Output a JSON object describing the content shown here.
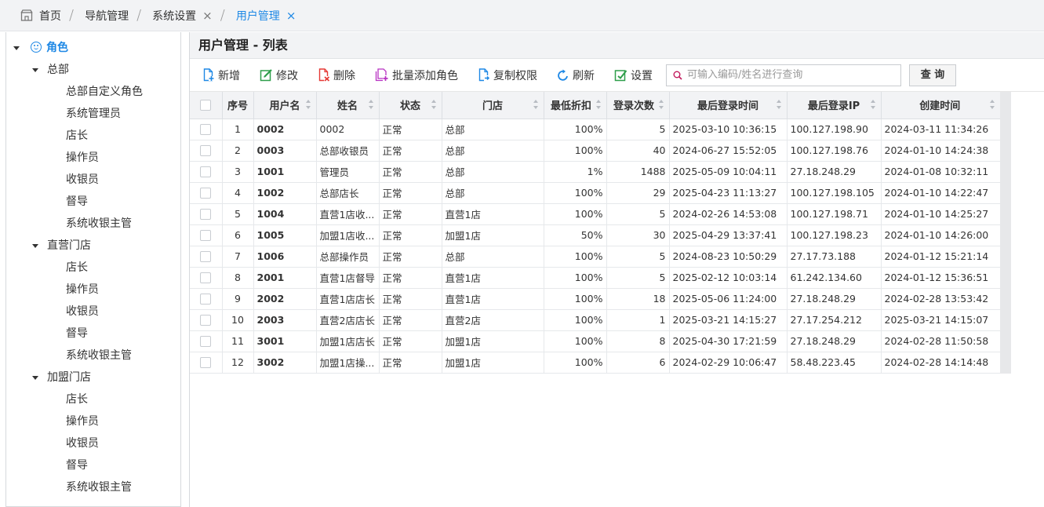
{
  "breadcrumb": {
    "items": [
      {
        "label": "首页"
      },
      {
        "label": "导航管理"
      },
      {
        "label": "系统设置"
      },
      {
        "label": "用户管理"
      }
    ],
    "close_glyph": "×"
  },
  "tree": {
    "root": "角色",
    "groups": [
      {
        "label": "总部",
        "children": [
          "总部自定义角色",
          "系统管理员",
          "店长",
          "操作员",
          "收银员",
          "督导",
          "系统收银主管"
        ]
      },
      {
        "label": "直营门店",
        "children": [
          "店长",
          "操作员",
          "收银员",
          "督导",
          "系统收银主管"
        ]
      },
      {
        "label": "加盟门店",
        "children": [
          "店长",
          "操作员",
          "收银员",
          "督导",
          "系统收银主管"
        ]
      }
    ]
  },
  "panel": {
    "title": "用户管理 - 列表"
  },
  "toolbar": {
    "buttons": [
      {
        "label": "新增",
        "icon": "add-doc-icon",
        "color": "#1e88e5"
      },
      {
        "label": "修改",
        "icon": "edit-icon",
        "color": "#2e9e4a"
      },
      {
        "label": "删除",
        "icon": "delete-doc-icon",
        "color": "#e53935"
      },
      {
        "label": "批量添加角色",
        "icon": "batch-add-role-icon",
        "color": "#b832c2"
      },
      {
        "label": "复制权限",
        "icon": "copy-permission-icon",
        "color": "#1e88e5"
      },
      {
        "label": "刷新",
        "icon": "refresh-icon",
        "color": "#1e88e5"
      },
      {
        "label": "设置",
        "icon": "settings-icon",
        "color": "#2e9e4a"
      }
    ],
    "search_placeholder": "可输入编码/姓名进行查询",
    "search_value": "",
    "query_label": "查 询"
  },
  "table": {
    "columns": [
      "序号",
      "用户名",
      "姓名",
      "状态",
      "门店",
      "最低折扣",
      "登录次数",
      "最后登录时间",
      "最后登录IP",
      "创建时间"
    ],
    "rows": [
      [
        "1",
        "0002",
        "0002",
        "正常",
        "总部",
        "100%",
        "5",
        "2025-03-10 10:36:15",
        "100.127.198.90",
        "2024-03-11 11:34:26"
      ],
      [
        "2",
        "0003",
        "总部收银员",
        "正常",
        "总部",
        "100%",
        "40",
        "2024-06-27 15:52:05",
        "100.127.198.76",
        "2024-01-10 14:24:38"
      ],
      [
        "3",
        "1001",
        "管理员",
        "正常",
        "总部",
        "1%",
        "1488",
        "2025-05-09 10:04:11",
        "27.18.248.29",
        "2024-01-08 10:32:11"
      ],
      [
        "4",
        "1002",
        "总部店长",
        "正常",
        "总部",
        "100%",
        "29",
        "2025-04-23 11:13:27",
        "100.127.198.105",
        "2024-01-10 14:22:47"
      ],
      [
        "5",
        "1004",
        "直营1店收...",
        "正常",
        "直营1店",
        "100%",
        "5",
        "2024-02-26 14:53:08",
        "100.127.198.71",
        "2024-01-10 14:25:27"
      ],
      [
        "6",
        "1005",
        "加盟1店收...",
        "正常",
        "加盟1店",
        "50%",
        "30",
        "2025-04-29 13:37:41",
        "100.127.198.23",
        "2024-01-10 14:26:00"
      ],
      [
        "7",
        "1006",
        "总部操作员",
        "正常",
        "总部",
        "100%",
        "5",
        "2024-08-23 10:50:29",
        "27.17.73.188",
        "2024-01-12 15:21:14"
      ],
      [
        "8",
        "2001",
        "直营1店督导",
        "正常",
        "直营1店",
        "100%",
        "5",
        "2025-02-12 10:03:14",
        "61.242.134.60",
        "2024-01-12 15:36:51"
      ],
      [
        "9",
        "2002",
        "直营1店店长",
        "正常",
        "直营1店",
        "100%",
        "18",
        "2025-05-06 11:24:00",
        "27.18.248.29",
        "2024-02-28 13:53:42"
      ],
      [
        "10",
        "2003",
        "直营2店店长",
        "正常",
        "直营2店",
        "100%",
        "1",
        "2025-03-21 14:15:27",
        "27.17.254.212",
        "2025-03-21 14:15:07"
      ],
      [
        "11",
        "3001",
        "加盟1店店长",
        "正常",
        "加盟1店",
        "100%",
        "8",
        "2025-04-30 17:21:59",
        "27.18.248.29",
        "2024-02-28 11:50:58"
      ],
      [
        "12",
        "3002",
        "加盟1店操...",
        "正常",
        "加盟1店",
        "100%",
        "6",
        "2024-02-29 10:06:47",
        "58.48.223.45",
        "2024-02-28 14:14:48"
      ]
    ]
  },
  "colors": {
    "accent": "#1e88e5",
    "code_link": "#2b6cb0"
  }
}
